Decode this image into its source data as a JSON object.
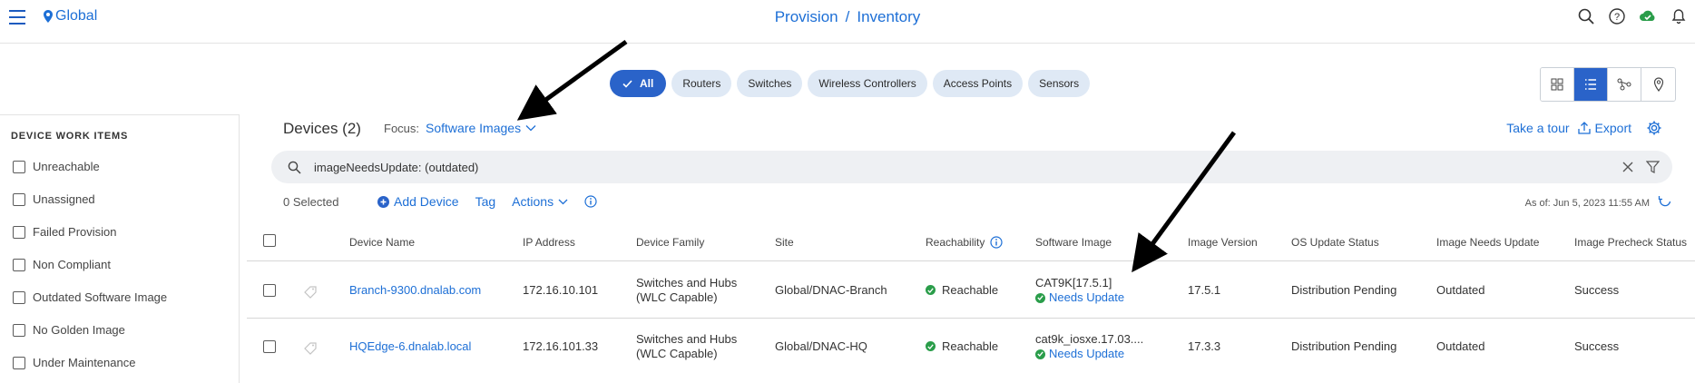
{
  "header": {
    "location": "Global",
    "breadcrumb": [
      "Provision",
      "Inventory"
    ],
    "separator": "/",
    "icons": [
      "search-icon",
      "help-icon",
      "health-check-icon",
      "notifications-icon"
    ]
  },
  "filters": {
    "chips": [
      "All",
      "Routers",
      "Switches",
      "Wireless Controllers",
      "Access Points",
      "Sensors"
    ],
    "active": "All",
    "views": [
      "grid-view-icon",
      "list-view-icon",
      "topology-view-icon",
      "map-view-icon"
    ],
    "active_view": "list-view-icon"
  },
  "sidebar": {
    "title": "DEVICE WORK ITEMS",
    "items": [
      {
        "label": "Unreachable"
      },
      {
        "label": "Unassigned"
      },
      {
        "label": "Failed Provision"
      },
      {
        "label": "Non Compliant"
      },
      {
        "label": "Outdated Software Image"
      },
      {
        "label": "No Golden Image"
      },
      {
        "label": "Under Maintenance"
      }
    ]
  },
  "main": {
    "devices_title": "Devices (2)",
    "focus_label": "Focus:",
    "focus_value": "Software Images",
    "take_tour": "Take a tour",
    "export": "Export",
    "search_value": "imageNeedsUpdate: (outdated)",
    "selected": "0 Selected",
    "add_device": "Add Device",
    "tag": "Tag",
    "actions": "Actions",
    "as_of": "As of: Jun 5, 2023 11:55 AM"
  },
  "table": {
    "columns": [
      "Device Name",
      "IP Address",
      "Device Family",
      "Site",
      "Reachability",
      "Software Image",
      "Image Version",
      "OS Update Status",
      "Image Needs Update",
      "Image Precheck Status"
    ],
    "rows": [
      {
        "device_name": "Branch-9300.dnalab.com",
        "ip": "172.16.10.101",
        "family_line1": "Switches and Hubs",
        "family_line2": "(WLC Capable)",
        "site": "Global/DNAC-Branch",
        "reachability": "Reachable",
        "software_image": "CAT9K[17.5.1]",
        "image_status": "Needs Update",
        "image_version": "17.5.1",
        "os_update_status": "Distribution Pending",
        "image_needs_update": "Outdated",
        "precheck": "Success"
      },
      {
        "device_name": "HQEdge-6.dnalab.local",
        "ip": "172.16.101.33",
        "family_line1": "Switches and Hubs",
        "family_line2": "(WLC Capable)",
        "site": "Global/DNAC-HQ",
        "reachability": "Reachable",
        "software_image": "cat9k_iosxe.17.03....",
        "image_status": "Needs Update",
        "image_version": "17.3.3",
        "os_update_status": "Distribution Pending",
        "image_needs_update": "Outdated",
        "precheck": "Success"
      }
    ]
  },
  "colors": {
    "accent": "#1d6fd6",
    "active_chip": "#2a63c9",
    "chip_bg": "#dfe9f5",
    "success": "#2a9d4a"
  }
}
